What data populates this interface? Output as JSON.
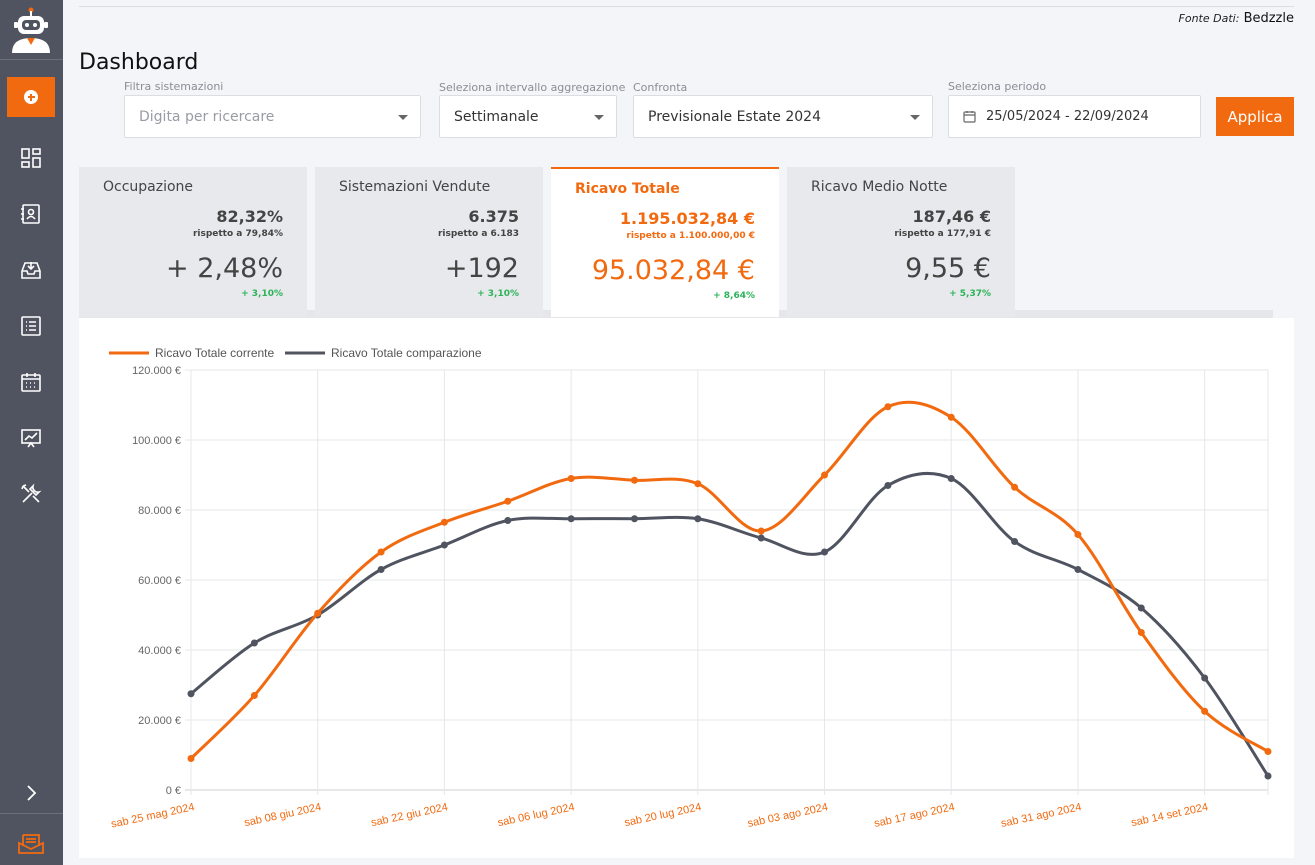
{
  "sidebar": {
    "items": [
      {
        "icon": "dashboard-icon"
      },
      {
        "icon": "contacts-icon"
      },
      {
        "icon": "inbox-icon"
      },
      {
        "icon": "list-icon"
      },
      {
        "icon": "calendar-icon"
      },
      {
        "icon": "chart-icon"
      },
      {
        "icon": "tools-icon"
      }
    ]
  },
  "header": {
    "source_label": "Fonte Dati:",
    "source_value": "Bedzzle",
    "title": "Dashboard"
  },
  "filters": {
    "accommodations_label": "Filtra sistemazioni",
    "accommodations_placeholder": "Digita per ricercare",
    "aggregation_label": "Seleziona intervallo aggregazione",
    "aggregation_value": "Settimanale",
    "compare_label": "Confronta",
    "compare_value": "Previsionale Estate 2024",
    "period_label": "Seleziona periodo",
    "period_value": "25/05/2024 - 22/09/2024",
    "apply_label": "Applica"
  },
  "kpis": [
    {
      "title": "Occupazione",
      "value": "82,32%",
      "compare": "rispetto a 79,84%",
      "delta": "+ 2,48%",
      "delta_pct": "+ 3,10%"
    },
    {
      "title": "Sistemazioni Vendute",
      "value": "6.375",
      "compare": "rispetto a 6.183",
      "delta": "+192",
      "delta_pct": "+ 3,10%"
    },
    {
      "title": "Ricavo Totale",
      "value": "1.195.032,84 €",
      "compare": "rispetto a 1.100.000,00 €",
      "delta": "95.032,84 €",
      "delta_pct": "+ 8,64%"
    },
    {
      "title": "Ricavo Medio Notte",
      "value": "187,46 €",
      "compare": "rispetto a 177,91 €",
      "delta": "9,55 €",
      "delta_pct": "+ 5,37%"
    }
  ],
  "colors": {
    "accent": "#f26a10",
    "comparison": "#505460",
    "positive": "#2db35a"
  },
  "chart_data": {
    "type": "line",
    "x": [
      "sab 25 mag 2024",
      "sab 01 giu 2024",
      "sab 08 giu 2024",
      "sab 15 giu 2024",
      "sab 22 giu 2024",
      "sab 29 giu 2024",
      "sab 06 lug 2024",
      "sab 13 lug 2024",
      "sab 20 lug 2024",
      "sab 27 lug 2024",
      "sab 03 ago 2024",
      "sab 10 ago 2024",
      "sab 17 ago 2024",
      "sab 24 ago 2024",
      "sab 31 ago 2024",
      "sab 07 set 2024",
      "sab 14 set 2024",
      "sab 21 set 2024"
    ],
    "tick_labels": [
      "sab 25 mag 2024",
      "sab 08 giu 2024",
      "sab 22 giu 2024",
      "sab 06 lug 2024",
      "sab 20 lug 2024",
      "sab 03 ago 2024",
      "sab 17 ago 2024",
      "sab 31 ago 2024",
      "sab 14 set 2024"
    ],
    "series": [
      {
        "name": "Ricavo Totale corrente",
        "color": "#f26a10",
        "values": [
          9000,
          27000,
          50500,
          68000,
          76500,
          82500,
          89000,
          88500,
          87500,
          74000,
          90000,
          109500,
          106500,
          86500,
          73000,
          45000,
          22500,
          11000
        ]
      },
      {
        "name": "Ricavo Totale comparazione",
        "color": "#505460",
        "values": [
          27500,
          42000,
          50000,
          63000,
          70000,
          77000,
          77500,
          77500,
          77500,
          72000,
          68000,
          87000,
          89000,
          71000,
          63000,
          52000,
          32000,
          4000
        ]
      }
    ],
    "y_ticks": [
      "0 €",
      "20.000 €",
      "40.000 €",
      "60.000 €",
      "80.000 €",
      "100.000 €",
      "120.000 €"
    ],
    "ylim": [
      0,
      120000
    ],
    "grid": true,
    "legend": "top-left"
  }
}
